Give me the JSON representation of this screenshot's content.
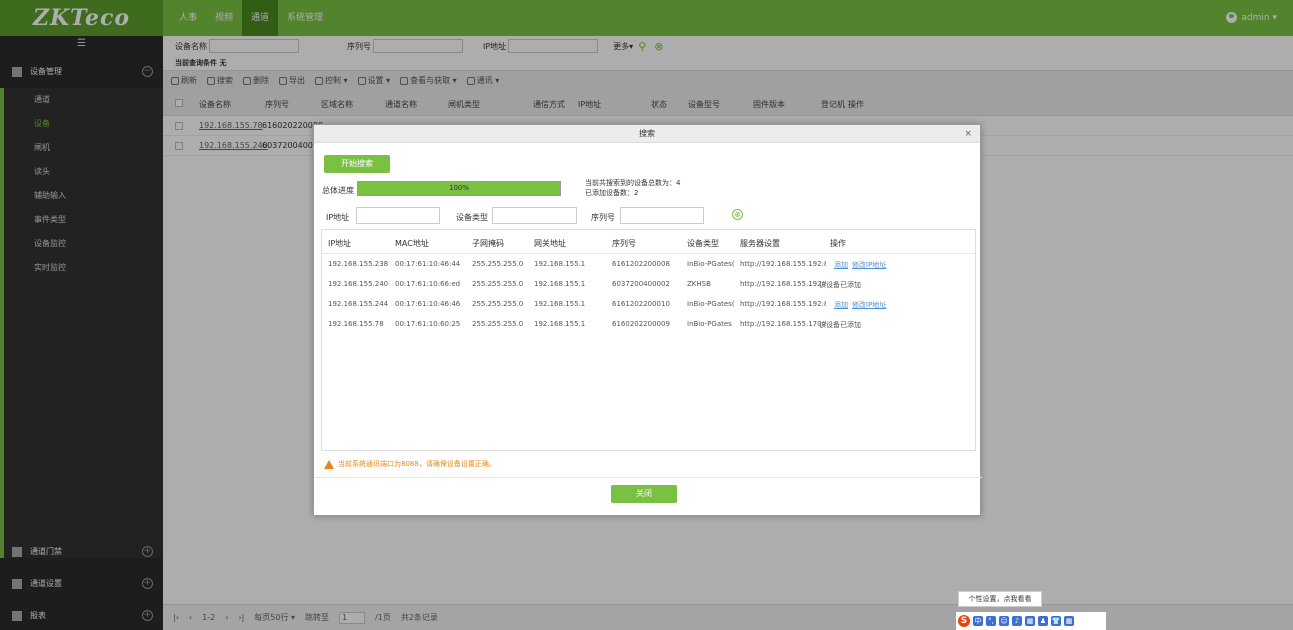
{
  "header": {
    "logo": "ZKTeco",
    "tabs": [
      "人事",
      "视频",
      "通道",
      "系统管理"
    ],
    "active_tab": 2,
    "user": "admin ▾"
  },
  "sidebar": {
    "toggle": "☰",
    "group_top": "设备管理",
    "items": [
      "通道",
      "设备",
      "闸机",
      "读头",
      "辅助输入",
      "事件类型",
      "设备监控",
      "实时监控"
    ],
    "active_item": 1,
    "groups_bottom": [
      "通道门禁",
      "通道设置",
      "报表"
    ]
  },
  "filter": {
    "device_name_label": "设备名称",
    "serial_label": "序列号",
    "ip_label": "IP地址",
    "more": "更多▾",
    "condition_label": "当前查询条件",
    "condition_value": "无"
  },
  "toolbar": {
    "items": [
      "刷新",
      "搜索",
      "删除",
      "导出",
      "控制 ▾",
      "设置 ▾",
      "查看与获取 ▾",
      "通讯 ▾"
    ]
  },
  "table": {
    "headers": [
      "设备名称",
      "序列号",
      "区域名称",
      "通道名称",
      "闸机类型",
      "通信方式",
      "IP地址",
      "状态",
      "设备型号",
      "固件版本",
      "登记机",
      "操作"
    ],
    "rows": [
      {
        "name": "192.168.155.78",
        "serial": "616020220000"
      },
      {
        "name": "192.168.155.240",
        "serial": "603720040000"
      }
    ]
  },
  "pager": {
    "pages": "1-2",
    "per_page": "每页50行 ▾",
    "jump_label": "跳转至",
    "jump_value": "1",
    "page_suffix": "/1页",
    "total": "共2条记录"
  },
  "dialog": {
    "title": "搜索",
    "close": "×",
    "start_button": "开始搜索",
    "progress_label": "总体进度",
    "progress_text": "100%",
    "progress_value": 1.0,
    "found_text": "当前共搜索到的设备总数为：4",
    "added_text": "已添加设备数：2",
    "ip_label": "IP地址",
    "type_label": "设备类型",
    "serial_label": "序列号",
    "clear_icon": "⊗",
    "columns": [
      "IP地址",
      "MAC地址",
      "子网掩码",
      "网关地址",
      "序列号",
      "设备类型",
      "服务器设置",
      "操作"
    ],
    "rows": [
      {
        "ip": "192.168.155.238",
        "mac": "00:17:61:10:46:44",
        "mask": "255.255.255.0",
        "gw": "192.168.155.1",
        "serial": "6161202200008",
        "type": "InBio-PGates(",
        "server": "http://192.168.155.192:8(",
        "ops": [
          "添加",
          "修改IP地址"
        ],
        "status": ""
      },
      {
        "ip": "192.168.155.240",
        "mac": "00:17:61:10:66:ed",
        "mask": "255.255.255.0",
        "gw": "192.168.155.1",
        "serial": "6037200400002",
        "type": "ZKHSB",
        "server": "http://192.168.155.192:8(",
        "ops": [],
        "status": "该设备已添加"
      },
      {
        "ip": "192.168.155.244",
        "mac": "00:17:61:10:46:46",
        "mask": "255.255.255.0",
        "gw": "192.168.155.1",
        "serial": "6161202200010",
        "type": "InBio-PGates(",
        "server": "http://192.168.155.192:8(",
        "ops": [
          "添加",
          "修改IP地址"
        ],
        "status": ""
      },
      {
        "ip": "192.168.155.78",
        "mac": "00:17:61:10:60:25",
        "mask": "255.255.255.0",
        "gw": "192.168.155.1",
        "serial": "6160202200009",
        "type": "InBio-PGates",
        "server": "http://192.168.155.170:8(",
        "ops": [],
        "status": "该设备已添加"
      }
    ],
    "warning": "当前系统通讯端口为8088，请确保设备设置正确。",
    "close_button": "关闭"
  },
  "tooltip": "个性设置，点我看看",
  "ime": {
    "logo": "S",
    "icons": [
      "中",
      "°,",
      "☺",
      "♪",
      "▦",
      "♟",
      "👕",
      "▦"
    ]
  }
}
